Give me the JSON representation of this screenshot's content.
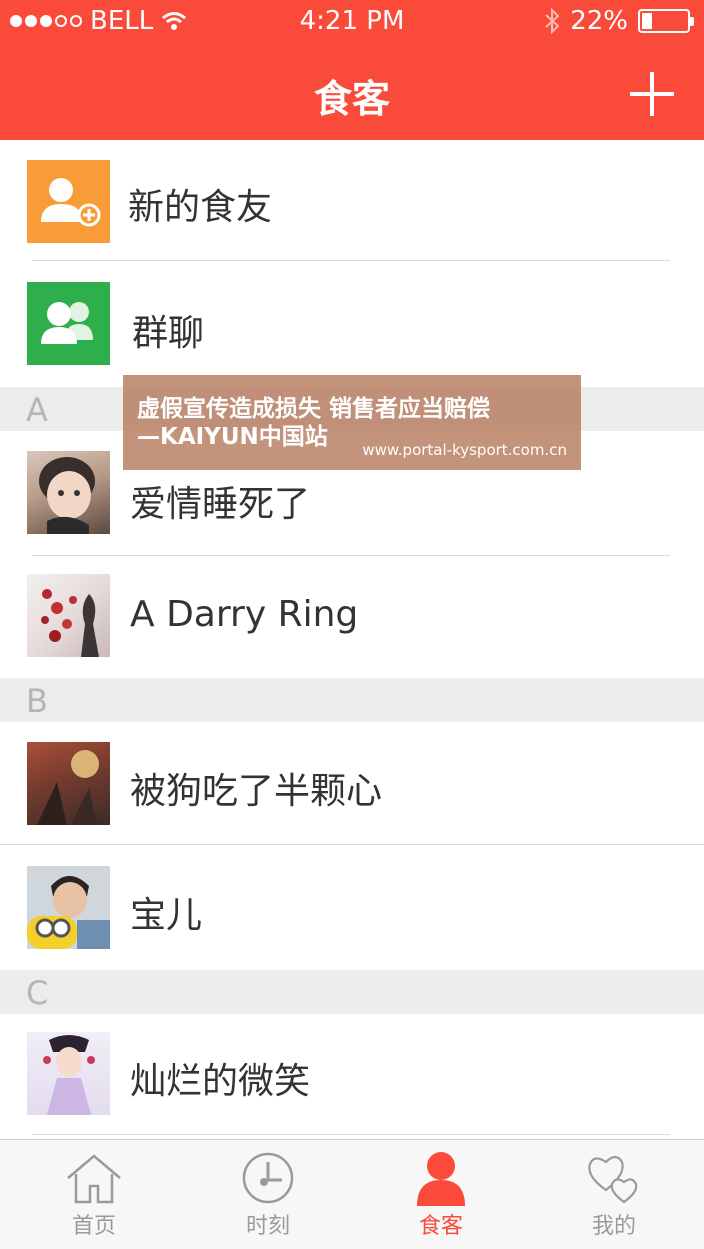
{
  "status_bar": {
    "carrier": "BELL",
    "time": "4:21 PM",
    "battery": "22%",
    "battery_level": 0.22,
    "icons": [
      "signal-dots-icon",
      "wifi-icon",
      "bluetooth-icon",
      "battery-icon"
    ]
  },
  "nav": {
    "title": "食客",
    "add_icon": "plus-icon"
  },
  "colors": {
    "accent": "#fa4a3a",
    "new_friend_tile": "#f89c37",
    "group_chat_tile": "#2fae4c",
    "section_bg": "#ececec"
  },
  "top_items": [
    {
      "label": "新的食友",
      "icon": "add-user-icon"
    },
    {
      "label": "群聊",
      "icon": "group-icon"
    }
  ],
  "sections": [
    {
      "letter": "A",
      "contacts": [
        {
          "name": "爱情睡死了"
        },
        {
          "name": "A  Darry Ring"
        }
      ]
    },
    {
      "letter": "B",
      "contacts": [
        {
          "name": "被狗吃了半颗心"
        },
        {
          "name": "宝儿"
        }
      ]
    },
    {
      "letter": "C",
      "contacts": [
        {
          "name": "灿烂的微笑"
        }
      ]
    }
  ],
  "tabs": [
    {
      "label": "首页",
      "icon": "home-icon"
    },
    {
      "label": "时刻",
      "icon": "clock-icon"
    },
    {
      "label": "食客",
      "icon": "person-icon",
      "active": true
    },
    {
      "label": "我的",
      "icon": "hearts-icon"
    }
  ],
  "overlay": {
    "line1": "虚假宣传造成损失 销售者应当赔偿",
    "line2": "—KAIYUN中国站",
    "url": "www.portal-kysport.com.cn"
  }
}
